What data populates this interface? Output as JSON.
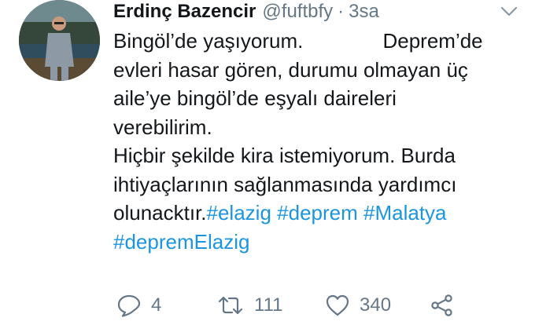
{
  "tweet": {
    "author_name": "Erdinç Bazencir",
    "handle": "@fuftbfy",
    "separator": "·",
    "time": "3sa",
    "text_lines": [
      "Bingöl’de yaşıyorum.              Deprem’de",
      "evleri hasar gören, durumu olmayan üç",
      "aile’ye bingöl’de eşyalı daireleri",
      "verebilirim.",
      "Hiçbir şekilde kira istemiyorum. Burda",
      "ihtiyaçlarının sağlanmasında yardımcı"
    ],
    "last_line_prefix": "olunacktır.",
    "hashtags": [
      "#elazig",
      "#deprem",
      "#Malatya",
      "#depremElazig"
    ]
  },
  "actions": {
    "reply_count": "4",
    "retweet_count": "111",
    "like_count": "340"
  },
  "icons": {
    "menu": "chevron-down-icon",
    "reply": "reply-icon",
    "retweet": "retweet-icon",
    "like": "heart-icon",
    "share": "share-icon"
  },
  "colors": {
    "hashtag": "#1b95e0",
    "secondary_text": "#657786",
    "primary_text": "#14171a"
  }
}
